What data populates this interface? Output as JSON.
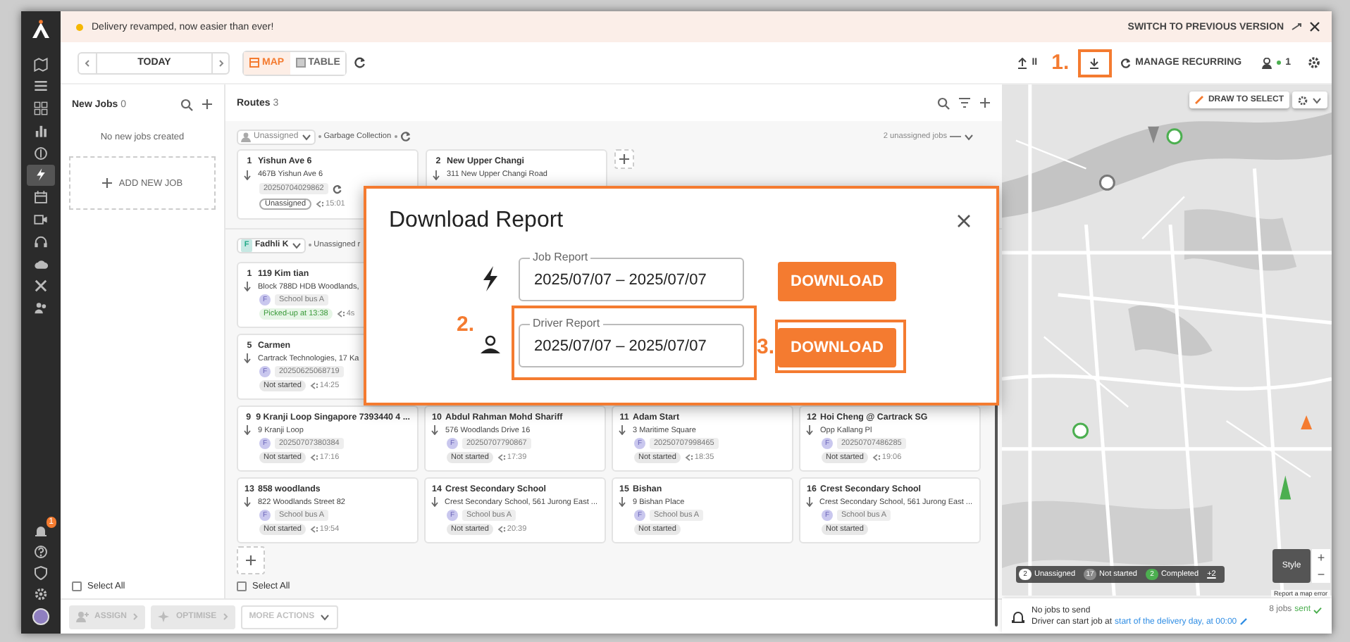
{
  "sidebar": {
    "items": [
      {
        "selected": false
      },
      {
        "selected": false
      },
      {
        "selected": false
      },
      {
        "selected": false
      },
      {
        "selected": false
      },
      {
        "selected": true
      },
      {
        "selected": false
      },
      {
        "selected": false
      },
      {
        "selected": false
      },
      {
        "selected": false
      },
      {
        "selected": false
      },
      {
        "selected": false
      }
    ],
    "notifications": "1"
  },
  "banner": {
    "text": "Delivery revamped, now easier than ever!",
    "switch": "SWITCH TO PREVIOUS VERSION"
  },
  "toolbar": {
    "date": "TODAY",
    "tabs": [
      {
        "label": "MAP",
        "selected": true
      },
      {
        "label": "TABLE",
        "selected": false
      }
    ],
    "import_label": "II",
    "manage": "MANAGE RECURRING",
    "drivers_count": "1"
  },
  "new_jobs": {
    "title": "New Jobs",
    "count": "0",
    "empty": "No new jobs created",
    "add": "ADD NEW JOB",
    "select_all": {
      "label": "Select All",
      "checked": false
    }
  },
  "routes": {
    "title": "Routes",
    "count": "3",
    "groups": [
      {
        "kind": "unassigned",
        "driver": "Unassigned",
        "label": "Garbage Collection",
        "summary": "2 unassigned jobs",
        "rows": [
          {
            "cards": [
              {
                "no": "1",
                "title": "Yishun Ave 6",
                "address": "467B Yishun Ave 6",
                "tag": "20250704029862",
                "status": "Unassigned",
                "kind": "unassigned",
                "time": "15:01"
              },
              {
                "no": "2",
                "title": "New Upper Changi",
                "address": "311 New Upper Changi Road"
              }
            ]
          }
        ]
      },
      {
        "kind": "driver",
        "initial": "F",
        "driver": "Fadhli K",
        "label": "Unassigned r",
        "rows": [
          {
            "cards": [
              {
                "no": "1",
                "title": "119 Kim tian",
                "address": "Block 788D HDB Woodlands,",
                "avatar": "F",
                "tag": "School bus A",
                "status": "Picked-up at 13:38",
                "kind": "picked",
                "time": "4s"
              }
            ]
          },
          {
            "cards": [
              {
                "no": "5",
                "title": "Carmen",
                "address": "Cartrack Technologies, 17 Ka",
                "avatar": "F",
                "tag": "20250625068719",
                "status": "Not started",
                "kind": "pending",
                "time": "14:25"
              }
            ]
          },
          {
            "cards": [
              {
                "no": "9",
                "title": "9 Kranji Loop Singapore 7393440 4 ...",
                "address": "9 Kranji Loop",
                "avatar": "F",
                "tag": "20250707380384",
                "status": "Not started",
                "kind": "pending",
                "time": "17:16"
              },
              {
                "no": "10",
                "title": "Abdul Rahman Mohd Shariff",
                "address": "576 Woodlands Drive 16",
                "avatar": "F",
                "tag": "20250707790867",
                "status": "Not started",
                "kind": "pending",
                "time": "17:39"
              },
              {
                "no": "11",
                "title": "Adam Start",
                "address": "3 Maritime Square",
                "avatar": "F",
                "tag": "20250707998465",
                "status": "Not started",
                "kind": "pending",
                "time": "18:35"
              },
              {
                "no": "12",
                "title": "Hoi Cheng @ Cartrack SG",
                "address": "Opp Kallang Pl",
                "avatar": "F",
                "tag": "20250707486285",
                "status": "Not started",
                "kind": "pending",
                "time": "19:06"
              }
            ]
          },
          {
            "cards": [
              {
                "no": "13",
                "title": "858 woodlands",
                "address": "822 Woodlands Street 82",
                "avatar": "F",
                "tag": "School bus A",
                "status": "Not started",
                "kind": "pending",
                "time": "19:54"
              },
              {
                "no": "14",
                "title": "Crest Secondary School",
                "address": "Crest Secondary School, 561 Jurong East ...",
                "avatar": "F",
                "tag": "School bus A",
                "status": "Not started",
                "kind": "pending",
                "time": "20:39"
              },
              {
                "no": "15",
                "title": "Bishan",
                "address": "9 Bishan Place",
                "avatar": "F",
                "tag": "School bus A",
                "status": "Not started",
                "kind": "pending"
              },
              {
                "no": "16",
                "title": "Crest Secondary School",
                "address": "Crest Secondary School, 561 Jurong East ...",
                "avatar": "F",
                "tag": "School bus A",
                "status": "Not started",
                "kind": "pending"
              }
            ]
          }
        ]
      }
    ],
    "select_all": {
      "label": "Select All",
      "checked": false
    }
  },
  "map": {
    "kind": "picture",
    "draw": "DRAW TO SELECT",
    "legend": [
      {
        "count": "2",
        "label": "Unassigned",
        "color": "#ffffff"
      },
      {
        "count": "17",
        "label": "Not started",
        "color": "#8a8a8a"
      },
      {
        "count": "2",
        "label": "Completed",
        "color": "#4caf50"
      }
    ],
    "more": "+2",
    "style": "Style",
    "zoom_in": "+",
    "zoom_out": "−",
    "report": "Report a map error"
  },
  "actions": [
    {
      "kind": "assign",
      "label": "ASSIGN",
      "disabled": true
    },
    {
      "kind": "optimise",
      "label": "OPTIMISE",
      "disabled": true
    },
    {
      "kind": "menu",
      "label": "MORE ACTIONS",
      "disabled": true
    }
  ],
  "notice": {
    "title": "No jobs to send",
    "text": "Driver can start job at",
    "link": "start of the delivery day, at 00:00",
    "sent_count": "8 jobs",
    "sent": "sent"
  },
  "modal": {
    "title": "Download Report",
    "reports": [
      {
        "kind": "job",
        "label": "Job Report",
        "value": "2025/07/07 – 2025/07/07",
        "button": "DOWNLOAD"
      },
      {
        "kind": "driver",
        "label": "Driver Report",
        "value": "2025/07/07 – 2025/07/07",
        "button": "DOWNLOAD"
      }
    ]
  },
  "annotations": [
    "1.",
    "2.",
    "3."
  ]
}
